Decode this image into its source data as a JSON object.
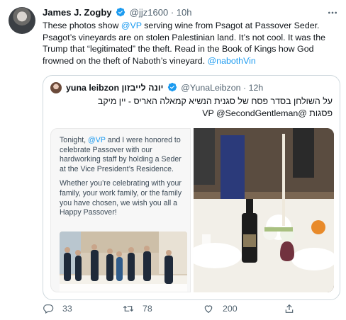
{
  "tweet": {
    "author_name": "James J. Zogby",
    "author_handle": "@jjz1600",
    "separator": "·",
    "time": "10h",
    "more_icon": "more-horizontal-icon",
    "text_before": "These photos show ",
    "mention_vp": "@VP",
    "text_after": " serving wine from Psagot at Passover Seder. Psagot’s vineyards are on stolen Palestinian land. It’s not cool. It was the Trump that “legitimated” the theft. Read in the Book of Kings how God frowned on the theft of Naboth’s vineyard. ",
    "mention_naboth": "@nabothVin"
  },
  "quote": {
    "author_name": "yuna leibzon יונה לייבזון",
    "author_handle": "@YunaLeibzon",
    "separator": "·",
    "time": "12h",
    "text_line1": "על השולחן בסדר פסח של סגנית הנשיא קמאלה האריס - יין מיקב",
    "text_line2_mention1": "@SecondGentleman",
    "text_line2_mention2": "@VP",
    "text_line2_word": "פסגות",
    "card": {
      "p1_before": "Tonight, ",
      "p1_mention": "@VP",
      "p1_after": " and I were honored to celebrate Passover with our hardworking staff by holding a Seder at the Vice President’s Residence.",
      "p2": "Whether you’re celebrating with your family, your work family, or the family you have chosen, we wish you all a Happy Passover!"
    }
  },
  "actions": {
    "reply_count": "33",
    "retweet_count": "78",
    "like_count": "200"
  },
  "colors": {
    "link": "#1d9bf0",
    "text": "#0f1419",
    "secondary": "#536471",
    "border": "#cfd9de"
  }
}
